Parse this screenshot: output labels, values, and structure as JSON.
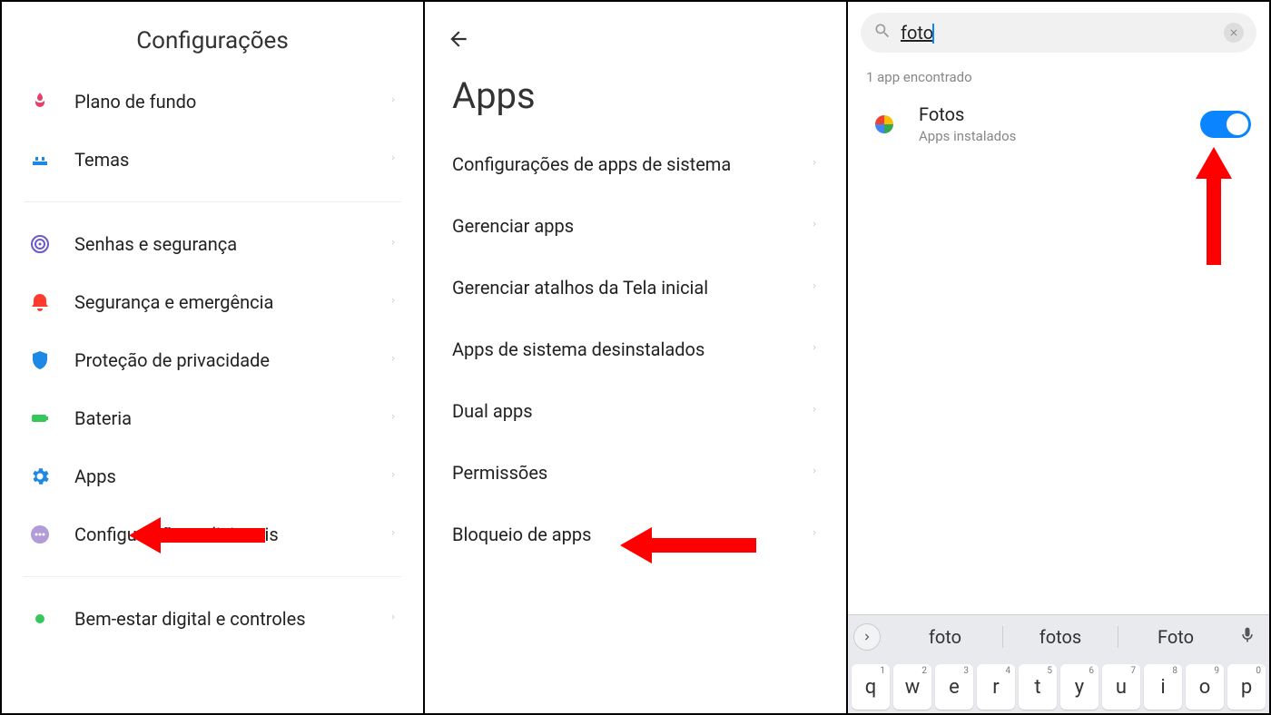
{
  "panel1": {
    "title": "Configurações",
    "items": [
      {
        "id": "wallpaper",
        "label": "Plano de fundo",
        "icon": "tulip",
        "color": "#e83e67"
      },
      {
        "id": "themes",
        "label": "Temas",
        "icon": "brush",
        "color": "#1e88e5"
      }
    ],
    "items2": [
      {
        "id": "passwords",
        "label": "Senhas e segurança",
        "icon": "fingerprint",
        "color": "#6a5acd"
      },
      {
        "id": "safety",
        "label": "Segurança e emergência",
        "icon": "alarm",
        "color": "#ff3b30"
      },
      {
        "id": "privacy",
        "label": "Proteção de privacidade",
        "icon": "shield",
        "color": "#1e88e5"
      },
      {
        "id": "battery",
        "label": "Bateria",
        "icon": "battery",
        "color": "#34c759"
      },
      {
        "id": "apps",
        "label": "Apps",
        "icon": "gear",
        "color": "#1e88e5"
      },
      {
        "id": "additional",
        "label": "Configurações adicionais",
        "icon": "dots",
        "color": "#b19cd9"
      }
    ],
    "items3": [
      {
        "id": "wellbeing",
        "label": "Bem-estar digital e controles",
        "icon": "dot",
        "color": "#34c759"
      }
    ]
  },
  "panel2": {
    "title": "Apps",
    "items": [
      {
        "id": "system-app-settings",
        "label": "Configurações de apps de sistema"
      },
      {
        "id": "manage-apps",
        "label": "Gerenciar apps"
      },
      {
        "id": "manage-shortcuts",
        "label": "Gerenciar atalhos da Tela inicial"
      },
      {
        "id": "uninstalled-system",
        "label": "Apps de sistema desinstalados"
      },
      {
        "id": "dual-apps",
        "label": "Dual apps"
      },
      {
        "id": "permissions",
        "label": "Permissões"
      },
      {
        "id": "app-lock",
        "label": "Bloqueio de apps"
      }
    ]
  },
  "panel3": {
    "search_value": "foto",
    "found_label": "1 app encontrado",
    "result": {
      "title": "Fotos",
      "subtitle": "Apps instalados",
      "toggle_on": true
    },
    "suggestions": [
      "foto",
      "fotos",
      "Foto"
    ],
    "kb_row1": [
      {
        "k": "q",
        "s": "1"
      },
      {
        "k": "w",
        "s": "2"
      },
      {
        "k": "e",
        "s": "3"
      },
      {
        "k": "r",
        "s": "4"
      },
      {
        "k": "t",
        "s": "5"
      },
      {
        "k": "y",
        "s": "6"
      },
      {
        "k": "u",
        "s": "7"
      },
      {
        "k": "i",
        "s": "8"
      },
      {
        "k": "o",
        "s": "9"
      },
      {
        "k": "p",
        "s": "0"
      }
    ]
  }
}
